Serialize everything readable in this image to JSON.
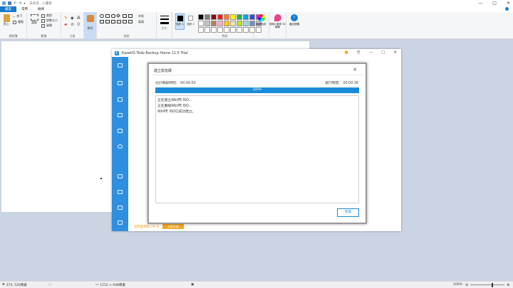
{
  "paint": {
    "title": "未命名 - 小畫家",
    "tabs": [
      "檔案",
      "常用",
      "檢視"
    ],
    "ribbon": {
      "clipboard": {
        "label": "剪貼簿",
        "paste": "貼上",
        "cut": "剪下",
        "copy": "複製"
      },
      "image": {
        "label": "影像",
        "select": "選取",
        "crop": "裁剪",
        "resize": "調整大小",
        "rotate": "旋轉"
      },
      "tools": {
        "label": "工具"
      },
      "brush": {
        "label": "筆刷"
      },
      "shapes": {
        "label": "形狀",
        "outline": "外框",
        "fill": "填滿"
      },
      "size": {
        "label": "大小"
      },
      "color1": "色彩 1",
      "color2": "色彩 2",
      "colors": {
        "label": "色彩",
        "edit": "編輯色彩"
      },
      "paint3d": "使用小畫家 3D 編輯",
      "alert": "產品提醒"
    },
    "palette": [
      "#000000",
      "#7f7f7f",
      "#880015",
      "#ed1c24",
      "#ff7f27",
      "#fff200",
      "#22b14c",
      "#00a2e8",
      "#3f48cc",
      "#a349a4",
      "#ffffff",
      "#c3c3c3",
      "#b97a57",
      "#ffaec9",
      "#ffc90e",
      "#efe4b0",
      "#b5e61d",
      "#99d9ea",
      "#7092be",
      "#c8bfe7",
      "#ffffff",
      "#ffffff",
      "#ffffff",
      "#ffffff",
      "#ffffff",
      "#ffffff",
      "#ffffff",
      "#ffffff",
      "#ffffff",
      "#ffffff"
    ],
    "status": {
      "cursor": "374, 520像素",
      "size": "1152 × 648像素",
      "zoom": "100%"
    }
  },
  "easeus": {
    "title": "EaseUS Todo Backup Home 11.5 Trial",
    "trial_text": "試用版剩餘 29 天",
    "trial_button": "立即升級"
  },
  "dialog": {
    "title": "建立緊急碟",
    "elapsed_label": "估計剩餘時間： 00:00:00",
    "used_label": "運行時間： 00:00:36",
    "progress": 100,
    "progress_text": "100%",
    "log": [
      "正在建立WinPE ISO...",
      "正在壓縮WinPE ISO...",
      "WinPE ISO已成功建立。"
    ],
    "done_button": "完成"
  }
}
